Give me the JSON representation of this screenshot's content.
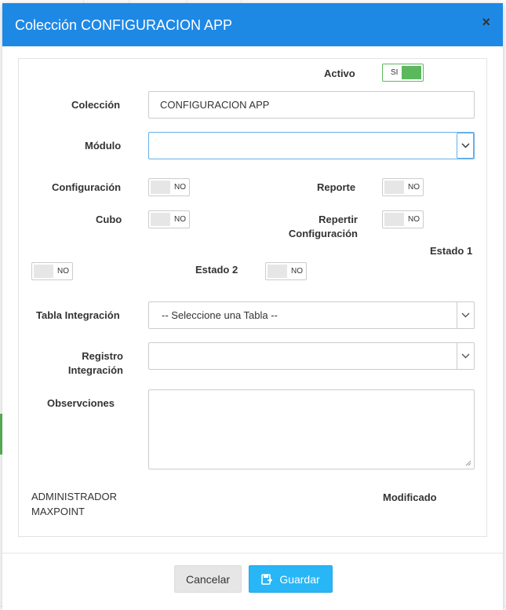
{
  "dialog": {
    "title": "Colección CONFIGURACION APP",
    "close_icon": "close-icon",
    "close_glyph": "×"
  },
  "form": {
    "activo": {
      "label": "Activo",
      "toggle_text": "SI",
      "state": "on"
    },
    "coleccion": {
      "label": "Colección",
      "value": "CONFIGURACION APP"
    },
    "modulo": {
      "label": "Módulo",
      "value": ""
    },
    "configuracion": {
      "label": "Configuración",
      "toggle_text": "NO"
    },
    "reporte": {
      "label": "Reporte",
      "toggle_text": "NO"
    },
    "cubo": {
      "label": "Cubo",
      "toggle_text": "NO"
    },
    "repertir_configuracion": {
      "label_line1": "Repertir",
      "label_line2": "Configuración",
      "toggle_text": "NO"
    },
    "estado1": {
      "label": "Estado 1",
      "toggle_text": "NO"
    },
    "estado2": {
      "label": "Estado 2",
      "toggle_text": "NO"
    },
    "tabla_integracion": {
      "label": "Tabla Integración",
      "value": "-- Seleccione una Tabla --"
    },
    "registro_integracion": {
      "label_line1": "Registro",
      "label_line2": "Integración",
      "value": ""
    },
    "observaciones": {
      "label": "Observciones",
      "value": ""
    },
    "user_line1": "ADMINISTRADOR",
    "user_line2": "MAXPOINT",
    "modificado_label": "Modificado"
  },
  "footer": {
    "cancel_label": "Cancelar",
    "save_label": "Guardar",
    "save_icon": "save-icon"
  },
  "colors": {
    "header": "#1e88e5",
    "toggle_on": "#5cb85c",
    "save_button": "#29b6f6"
  }
}
